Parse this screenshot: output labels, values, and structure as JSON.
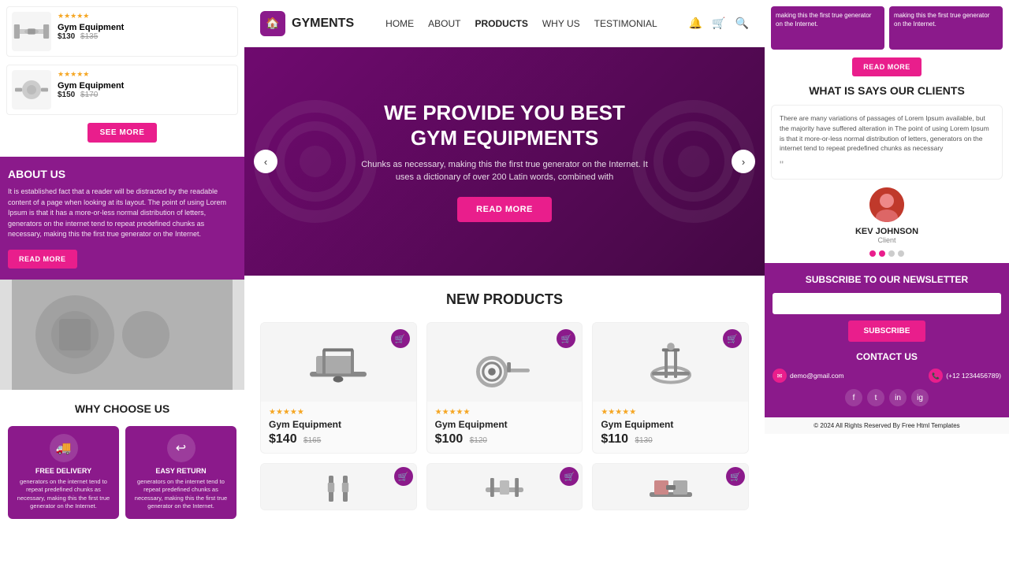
{
  "brand": {
    "name": "GYMENTS",
    "icon": "🏠"
  },
  "navbar": {
    "links": [
      {
        "label": "HOME",
        "active": false
      },
      {
        "label": "ABOUT",
        "active": false
      },
      {
        "label": "PRODUCTS",
        "active": true
      },
      {
        "label": "WHY US",
        "active": false
      },
      {
        "label": "TESTIMONIAL",
        "active": false
      }
    ]
  },
  "hero": {
    "heading_line1": "WE PROVIDE YOU BEST",
    "heading_line2": "GYM EQUIPMENTS",
    "description": "Chunks as necessary, making this the first true generator on the Internet. It uses a dictionary of over 200 Latin words, combined with",
    "cta_label": "READ MORE",
    "arrow_left": "‹",
    "arrow_right": "›"
  },
  "products_section": {
    "title": "NEW PRODUCTS",
    "products": [
      {
        "name": "Gym Equipment",
        "price_new": "$140",
        "price_old": "$165",
        "stars": "★★★★★",
        "cart_icon": "🛒"
      },
      {
        "name": "Gym Equipment",
        "price_new": "$100",
        "price_old": "$120",
        "stars": "★★★★★",
        "cart_icon": "🛒"
      },
      {
        "name": "Gym Equipment",
        "price_new": "$110",
        "price_old": "$130",
        "stars": "★★★★★",
        "cart_icon": "🛒"
      }
    ]
  },
  "left_panel": {
    "products": [
      {
        "name": "Gym Equipment",
        "price_new": "$130",
        "price_old": "$135",
        "stars": "★★★★★"
      },
      {
        "name": "Gym Equipment",
        "price_new": "$150",
        "price_old": "$170",
        "stars": "★★★★★"
      }
    ],
    "see_more_label": "SEE MORE",
    "about": {
      "title": "ABOUT US",
      "text": "It is established fact that a reader will be distracted by the readable content of a page when looking at its layout. The point of using Lorem Ipsum is that it has a more-or-less normal distribution of letters, generators on the internet tend to repeat predefined chunks as necessary, making this the first true generator on the Internet.",
      "btn_label": "READ MORE"
    },
    "why_choose": {
      "title": "WHY CHOOSE US",
      "items": [
        {
          "icon": "🚚",
          "name": "FREE DELIVERY",
          "desc": "generators on the internet tend to repeat predefined chunks as necessary, making this the first true generator on the Internet."
        },
        {
          "icon": "↩",
          "name": "EASY RETURN",
          "desc": "generators on the internet tend to repeat predefined chunks as necessary, making this the first true generator on the Internet."
        }
      ]
    }
  },
  "right_panel": {
    "partial_cards": [
      "making this the first true generator on the Internet.",
      "making this the first true generator on the Internet."
    ],
    "read_more_label": "READ MORE",
    "testimonial": {
      "section_title": "WHAT IS SAYS OUR CLIENTS",
      "text": "There are many variations of passages of Lorem Ipsum available, but the majority have suffered alteration in The point of using Lorem Ipsum is that it more-or-less normal distribution of letters, generators on the internet tend to repeat predefined chunks as necessary",
      "quote_mark": "\"",
      "reviewer_name": "KEV JOHNSON",
      "reviewer_role": "Client",
      "dots": [
        true,
        true,
        false,
        false
      ]
    },
    "subscribe": {
      "title": "SUBSCRIBE TO OUR NEWSLETTER",
      "placeholder": "",
      "btn_label": "SUBSCRIBE"
    },
    "contact": {
      "title": "CONTACT US",
      "email": "demo@gmail.com",
      "phone": "(+12 1234456789)"
    },
    "social_icons": [
      "f",
      "t",
      "in",
      "ig"
    ],
    "footer_copy": "© 2024 All Rights Reserved By Free Html Templates"
  }
}
